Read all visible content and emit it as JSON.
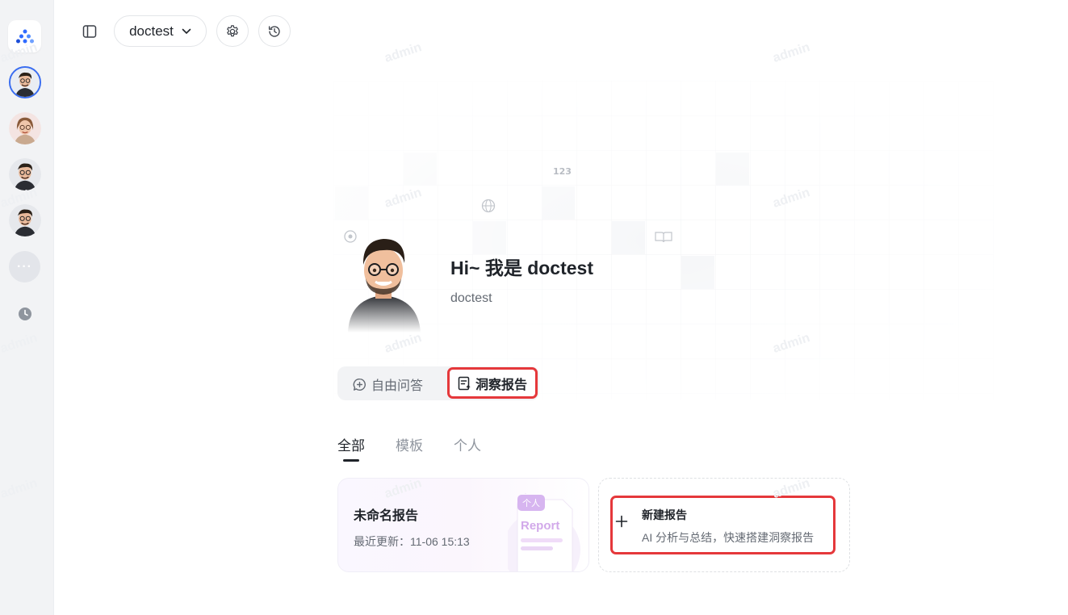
{
  "header": {
    "agent_name": "doctest"
  },
  "hero": {
    "greeting": "Hi~ 我是 doctest",
    "subtitle": "doctest"
  },
  "modes": {
    "free_qa": "自由问答",
    "insight_report": "洞察报告"
  },
  "tabs": [
    {
      "label": "全部",
      "active": true
    },
    {
      "label": "模板",
      "active": false
    },
    {
      "label": "个人",
      "active": false
    }
  ],
  "cards": {
    "report": {
      "title": "未命名报告",
      "updated": "最近更新：11-06 15:13",
      "badge": "个人",
      "illustration_word": "Report"
    },
    "new": {
      "title": "新建报告",
      "subtitle": "AI 分析与总结，快速搭建洞察报告"
    }
  },
  "watermark": "admin",
  "colors": {
    "highlight": "#e5383b",
    "rail_bg": "#f2f3f5",
    "accent_purple": "#c9a5e8"
  }
}
